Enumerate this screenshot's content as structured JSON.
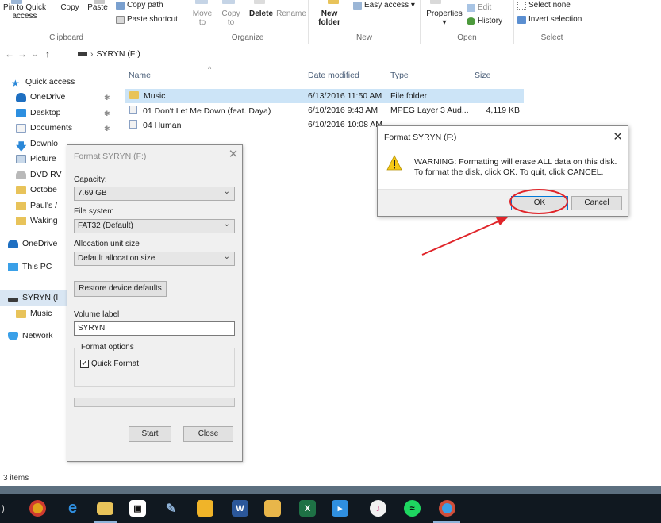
{
  "ribbon": {
    "clipboard": {
      "pin": "Pin to Quick access",
      "copy": "Copy",
      "paste": "Paste",
      "paste_shortcut": "Paste shortcut",
      "copy_path": "Copy path",
      "label": "Clipboard"
    },
    "organize": {
      "move": "Move to",
      "copy": "Copy to",
      "delete": "Delete",
      "rename": "Rename",
      "label": "Organize"
    },
    "new": {
      "new_folder": "New folder",
      "easy_access": "Easy access ▾",
      "label": "New"
    },
    "open": {
      "properties": "Properties",
      "edit": "Edit",
      "history": "History",
      "label": "Open"
    },
    "select": {
      "select_none": "Select none",
      "invert": "Invert selection",
      "label": "Select"
    }
  },
  "address": {
    "path": "SYRYN (F:)"
  },
  "sidebar": {
    "items": [
      {
        "label": "Quick access",
        "pinned": false
      },
      {
        "label": "OneDrive",
        "pinned": true
      },
      {
        "label": "Desktop",
        "pinned": true
      },
      {
        "label": "Documents",
        "pinned": true
      },
      {
        "label": "Downlo",
        "pinned": false
      },
      {
        "label": "Picture",
        "pinned": false
      },
      {
        "label": "DVD RV",
        "pinned": false
      },
      {
        "label": "Octobe",
        "pinned": false
      },
      {
        "label": "Paul's /",
        "pinned": false
      },
      {
        "label": "Waking",
        "pinned": false
      },
      {
        "label": "OneDrive",
        "pinned": false
      },
      {
        "label": "This PC",
        "pinned": false
      },
      {
        "label": "SYRYN (I",
        "pinned": false
      },
      {
        "label": "Music",
        "pinned": false
      },
      {
        "label": "Network",
        "pinned": false
      }
    ]
  },
  "filelist": {
    "headers": {
      "name": "Name",
      "date": "Date modified",
      "type": "Type",
      "size": "Size"
    },
    "rows": [
      {
        "name": "Music",
        "date": "6/13/2016 11:50 AM",
        "type": "File folder",
        "size": ""
      },
      {
        "name": "01 Don't Let Me Down (feat. Daya)",
        "date": "6/10/2016 9:43 AM",
        "type": "MPEG Layer 3 Aud...",
        "size": "4,119 KB"
      },
      {
        "name": "04 Human",
        "date": "6/10/2016 10:08 AM",
        "type": "",
        "size": ""
      }
    ]
  },
  "status": {
    "items": "3 items"
  },
  "format_dialog": {
    "title": "Format SYRYN (F:)",
    "capacity_label": "Capacity:",
    "capacity_value": "7.69 GB",
    "fs_label": "File system",
    "fs_value": "FAT32 (Default)",
    "alloc_label": "Allocation unit size",
    "alloc_value": "Default allocation size",
    "restore_label": "Restore device defaults",
    "volume_label": "Volume label",
    "volume_value": "SYRYN",
    "options_label": "Format options",
    "quick_format_label": "Quick Format",
    "quick_format_checked": true,
    "start_label": "Start",
    "close_label": "Close"
  },
  "warning_dialog": {
    "title": "Format SYRYN (F:)",
    "line1": "WARNING: Formatting will erase ALL data on this disk.",
    "line2": "To format the disk, click OK. To quit, click CANCEL.",
    "ok_label": "OK",
    "cancel_label": "Cancel"
  },
  "taskbar": {
    "apps": [
      "chrome-icon",
      "edge-icon",
      "file-explorer-icon",
      "store-icon",
      "paint-icon",
      "lightbulb-icon",
      "word-icon",
      "calculator-icon",
      "excel-icon",
      "media-player-icon",
      "itunes-icon",
      "spotify-icon",
      "chrome-canary-icon"
    ]
  },
  "colors": {
    "accent": "#0078d7",
    "selection": "#cce4f7",
    "annotation": "#e0252a"
  }
}
